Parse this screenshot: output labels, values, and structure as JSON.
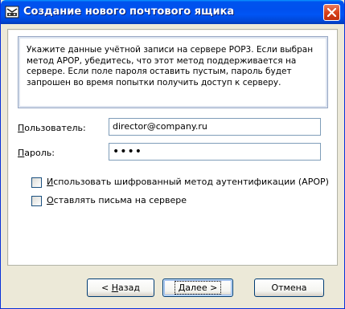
{
  "window": {
    "title": "Создание нового почтового ящика"
  },
  "info": {
    "text": "Укажите данные учётной записи на сервере POP3. Если выбран метод APOP, убедитесь, что этот метод поддерживается на сервере. Если поле пароля оставить пустым, пароль будет запрошен во время попытки получить доступ к серверу."
  },
  "form": {
    "user_label_prefix": "",
    "user_label_mnemonic": "П",
    "user_label_rest": "ользователь:",
    "user_value": "director@company.ru",
    "password_label_mnemonic": "П",
    "password_label_rest": "ароль:",
    "password_value": "••••",
    "apop_mnemonic": "И",
    "apop_rest": "спользовать шифрованный метод аутентификации (APOP)",
    "apop_checked": false,
    "leave_mnemonic": "О",
    "leave_rest": "ставлять письма на сервере",
    "leave_checked": false
  },
  "buttons": {
    "back_prefix": "< ",
    "back_mnemonic": "Н",
    "back_rest": "азад",
    "next_mnemonic": "Д",
    "next_rest": "алее >",
    "cancel": "Отмена"
  },
  "icons": {
    "title_icon": "mailbox-app-icon",
    "close_icon": "close-icon"
  },
  "colors": {
    "titlebar": "#0053ee",
    "close": "#d9421b",
    "dialog_bg": "#ece9d8"
  }
}
